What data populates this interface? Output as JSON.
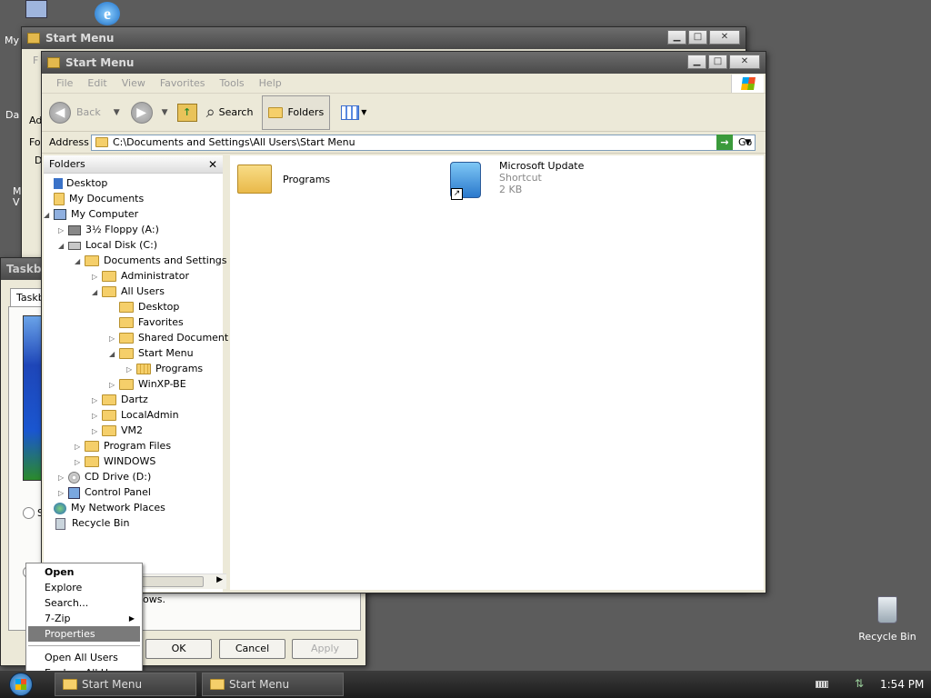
{
  "desktop": {
    "icons": {
      "my_computer_fragment": "My",
      "recycle_bin": "Recycle Bin"
    },
    "left_fragments": [
      "Da",
      "M",
      "V"
    ]
  },
  "back_window": {
    "title": "Start Menu",
    "menu_fragment": "F",
    "row1": "Ad",
    "row2": "Fo",
    "row3": "D"
  },
  "taskbar_props": {
    "title": "Taskbar",
    "tab": "Taskb",
    "radio_fragment": "S",
    "text_fragment": "ows.",
    "buttons": {
      "ok": "OK",
      "cancel": "Cancel",
      "apply": "Apply"
    }
  },
  "explorer": {
    "title": "Start Menu",
    "menu": [
      "File",
      "Edit",
      "View",
      "Favorites",
      "Tools",
      "Help"
    ],
    "toolbar": {
      "back": "Back",
      "search": "Search",
      "folders": "Folders"
    },
    "address_label": "Address",
    "address_value": "C:\\Documents and Settings\\All Users\\Start Menu",
    "go": "Go",
    "folders_pane_title": "Folders",
    "tree": [
      {
        "label": "Desktop"
      },
      {
        "label": "My Documents"
      },
      {
        "label": "My Computer"
      },
      {
        "label": "3½ Floppy (A:)"
      },
      {
        "label": "Local Disk (C:)"
      },
      {
        "label": "Documents and Settings"
      },
      {
        "label": "Administrator"
      },
      {
        "label": "All Users"
      },
      {
        "label": "Desktop"
      },
      {
        "label": "Favorites"
      },
      {
        "label": "Shared Document"
      },
      {
        "label": "Start Menu"
      },
      {
        "label": "Programs"
      },
      {
        "label": "WinXP-BE"
      },
      {
        "label": "Dartz"
      },
      {
        "label": "LocalAdmin"
      },
      {
        "label": "VM2"
      },
      {
        "label": "Program Files"
      },
      {
        "label": "WINDOWS"
      },
      {
        "label": "CD Drive (D:)"
      },
      {
        "label": "Control Panel"
      },
      {
        "label": "My Network Places"
      },
      {
        "label": "Recycle Bin"
      }
    ],
    "files": [
      {
        "name": "Programs"
      },
      {
        "name": "Microsoft Update",
        "type": "Shortcut",
        "size": "2 KB"
      }
    ]
  },
  "context_menu": {
    "items": [
      "Open",
      "Explore",
      "Search...",
      "7-Zip",
      "Properties",
      "Open All Users",
      "Explore All Users"
    ]
  },
  "taskbar": {
    "tasks": [
      "Start Menu",
      "Start Menu"
    ],
    "clock": "1:54 PM"
  },
  "colors": {
    "highlight": "#7a7a7a",
    "folder": "#f5cf6a"
  }
}
